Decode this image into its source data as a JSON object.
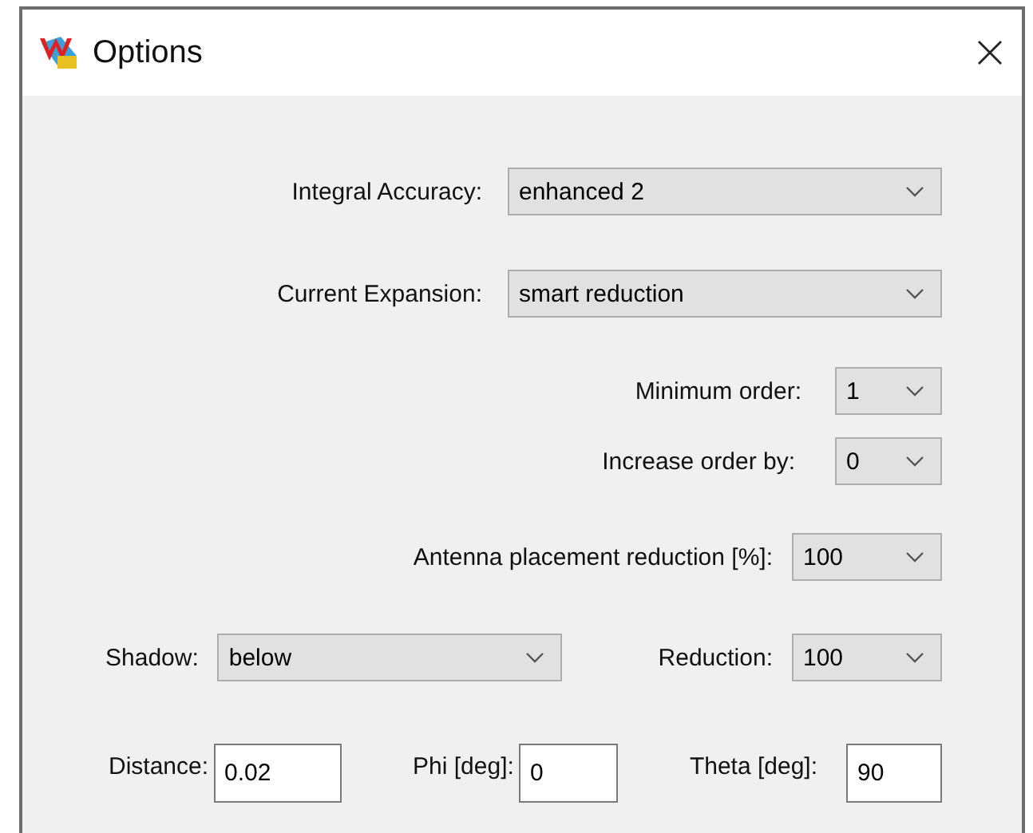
{
  "window": {
    "title": "Options"
  },
  "rows": [
    [
      {
        "kind": "combo",
        "label": "Integral Accuracy:",
        "value": "enhanced 2"
      }
    ],
    [
      {
        "kind": "combo",
        "label": "Current Expansion:",
        "value": "smart reduction"
      }
    ],
    [
      {
        "kind": "combo",
        "label": "Minimum order:",
        "value": "1"
      }
    ],
    [
      {
        "kind": "combo",
        "label": "Increase order by:",
        "value": "0"
      }
    ],
    [
      {
        "kind": "combo",
        "label": "Antenna placement reduction [%]:",
        "value": "100"
      }
    ],
    [
      {
        "kind": "combo",
        "label": "Shadow:",
        "value": "below"
      },
      {
        "kind": "combo",
        "label": "Reduction:",
        "value": "100"
      }
    ],
    [
      {
        "kind": "text",
        "label": "Distance:",
        "value": "0.02"
      },
      {
        "kind": "text",
        "label": "Phi [deg]:",
        "value": "0"
      },
      {
        "kind": "text",
        "label": "Theta [deg]:",
        "value": "90"
      }
    ]
  ]
}
